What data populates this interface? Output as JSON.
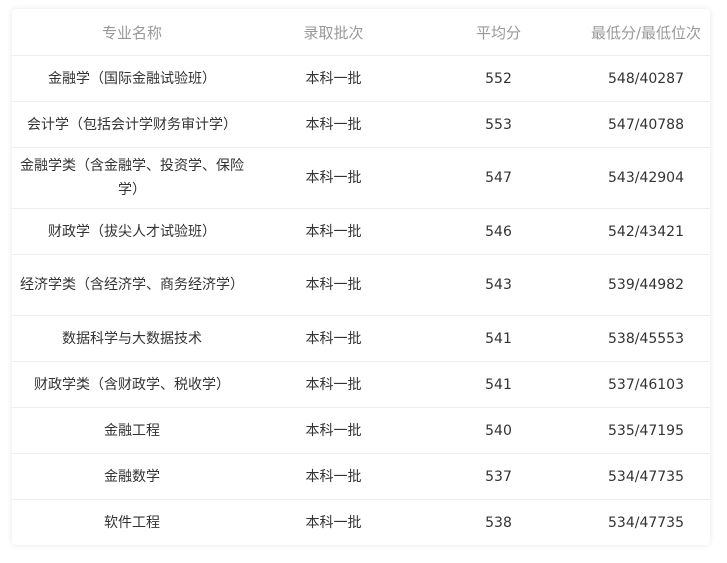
{
  "table": {
    "headers": {
      "major": "专业名称",
      "batch": "录取批次",
      "avg": "平均分",
      "min": "最低分/最低位次"
    },
    "rows": [
      {
        "major": "金融学（国际金融试验班）",
        "batch": "本科一批",
        "avg": "552",
        "min": "548/40287"
      },
      {
        "major": "会计学（包括会计学财务审计学）",
        "batch": "本科一批",
        "avg": "553",
        "min": "547/40788"
      },
      {
        "major": "金融学类（含金融学、投资学、保险学）",
        "batch": "本科一批",
        "avg": "547",
        "min": "543/42904"
      },
      {
        "major": "财政学（拔尖人才试验班）",
        "batch": "本科一批",
        "avg": "546",
        "min": "542/43421"
      },
      {
        "major": "经济学类（含经济学、商务经济学）",
        "batch": "本科一批",
        "avg": "543",
        "min": "539/44982"
      },
      {
        "major": "数据科学与大数据技术",
        "batch": "本科一批",
        "avg": "541",
        "min": "538/45553"
      },
      {
        "major": "财政学类（含财政学、税收学）",
        "batch": "本科一批",
        "avg": "541",
        "min": "537/46103"
      },
      {
        "major": "金融工程",
        "batch": "本科一批",
        "avg": "540",
        "min": "535/47195"
      },
      {
        "major": "金融数学",
        "batch": "本科一批",
        "avg": "537",
        "min": "534/47735"
      },
      {
        "major": "软件工程",
        "batch": "本科一批",
        "avg": "538",
        "min": "534/47735"
      }
    ]
  }
}
